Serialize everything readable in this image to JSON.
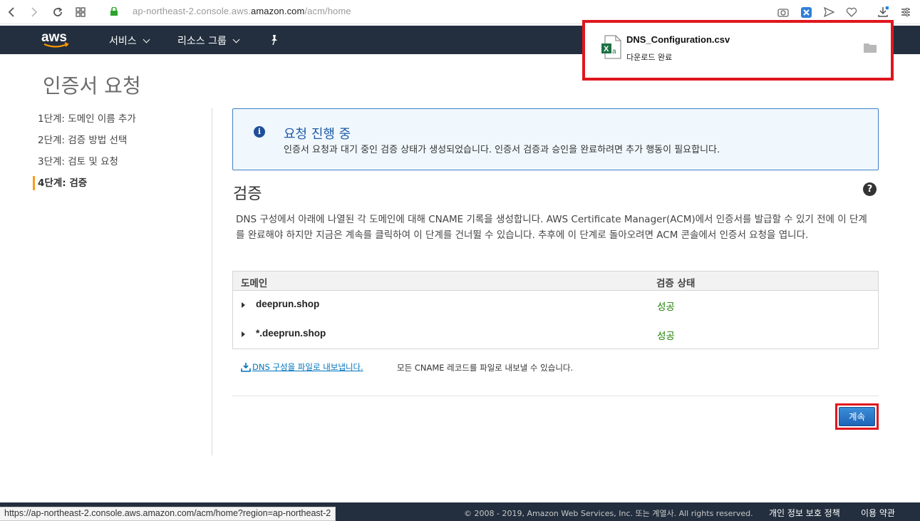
{
  "browser": {
    "url_prefix": "ap-northeast-2.console.aws.",
    "url_domain": "amazon.com",
    "url_path": "/acm/home"
  },
  "navbar": {
    "logo": "aws",
    "services_label": "서비스",
    "resource_groups_label": "리소스 그룹"
  },
  "download": {
    "filename": "DNS_Configuration.csv",
    "status": "다운로드 완료"
  },
  "page": {
    "title": "인증서 요청",
    "steps": [
      {
        "label": "1단계: 도메인 이름 추가"
      },
      {
        "label": "2단계: 검증 방법 선택"
      },
      {
        "label": "3단계: 검토 및 요청"
      },
      {
        "label": "4단계: 검증"
      }
    ]
  },
  "info": {
    "title": "요청 진행 중",
    "text": "인증서 요청과 대기 중인 검증 상태가 생성되었습니다. 인증서 검증과 승인을 완료하려면 추가 행동이 필요합니다."
  },
  "validation": {
    "title": "검증",
    "description": "DNS 구성에서 아래에 나열된 각 도메인에 대해 CNAME 기록을 생성합니다. AWS Certificate Manager(ACM)에서 인증서를 발급할 수 있기 전에 이 단계를 완료해야 하지만 지금은 계속를 클릭하여 이 단계를 건너뛸 수 있습니다. 추후에 이 단계로 돌아오려면 ACM 콘솔에서 인증서 요청을 엽니다.",
    "columns": {
      "domain": "도메인",
      "status": "검증 상태"
    },
    "rows": [
      {
        "domain": "deeprun.shop",
        "status": "성공"
      },
      {
        "domain": "*.deeprun.shop",
        "status": "성공"
      }
    ],
    "export_link": "DNS 구성을 파일로 내보냅니다.",
    "export_note": "모든 CNAME 레코드를 파일로 내보낼 수 있습니다.",
    "continue_label": "계속"
  },
  "footer": {
    "copyright": "© 2008 - 2019, Amazon Web Services, Inc. 또는 계열사. All rights reserved.",
    "privacy": "개인 정보 보호 정책",
    "terms": "이용 약관"
  },
  "statusbar": {
    "url": "https://ap-northeast-2.console.aws.amazon.com/acm/home?region=ap-northeast-2"
  },
  "colors": {
    "navbar": "#232f3e",
    "highlight_border": "#e0161e",
    "success": "#1d8102",
    "link": "#0073bb",
    "active_step": "#f79e1b"
  }
}
